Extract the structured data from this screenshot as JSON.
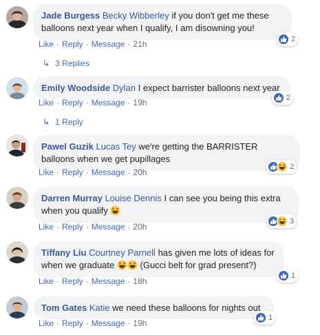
{
  "actions": {
    "like": "Like",
    "reply": "Reply",
    "message": "Message"
  },
  "comments": [
    {
      "author": "Jade Burgess",
      "tag": "Becky Wibberley",
      "text": "if you don't get me these balloons next year when I qualify, I am disowning you!",
      "time": "21h",
      "reactions": [
        "like"
      ],
      "reaction_count": "2",
      "replies": "3 Replies"
    },
    {
      "author": "Emily Woodside",
      "tag": "Dylan",
      "text": "I expect barrister balloons next year",
      "time": "19h",
      "reactions": [
        "like"
      ],
      "reaction_count": "2",
      "replies": "1 Reply"
    },
    {
      "author": "Pawel Guzik",
      "tag": "Lucas Tey",
      "text": "we're getting the BARRISTER balloons when we get pupillages",
      "time": "20h",
      "reactions": [
        "like",
        "haha"
      ],
      "reaction_count": "2"
    },
    {
      "author": "Darren Murray",
      "tag": "Louise Dennis",
      "text": "I can see you being this extra when you qualify",
      "emoji_after": "laughing-emoji",
      "time": "20h",
      "reactions": [
        "like",
        "haha"
      ],
      "reaction_count": "3"
    },
    {
      "author": "Tiffany Liu",
      "tag": "Courtney Parnell",
      "text_a": "has given me lots of ideas for when we graduate",
      "text_b": "(Gucci belt for grad present?)",
      "time": "18h",
      "reactions": [
        "like"
      ],
      "reaction_count": "1"
    },
    {
      "author": "Tom Gates",
      "tag": "Katie",
      "text": "we need these balloons for nights out",
      "time": "19h",
      "reactions": [
        "like"
      ],
      "reaction_count": "1"
    }
  ],
  "colors": {
    "link": "#385898",
    "action": "#4267b2",
    "bubble": "#f2f3f5",
    "like": "#4267b2",
    "haha": "#f7c948"
  }
}
